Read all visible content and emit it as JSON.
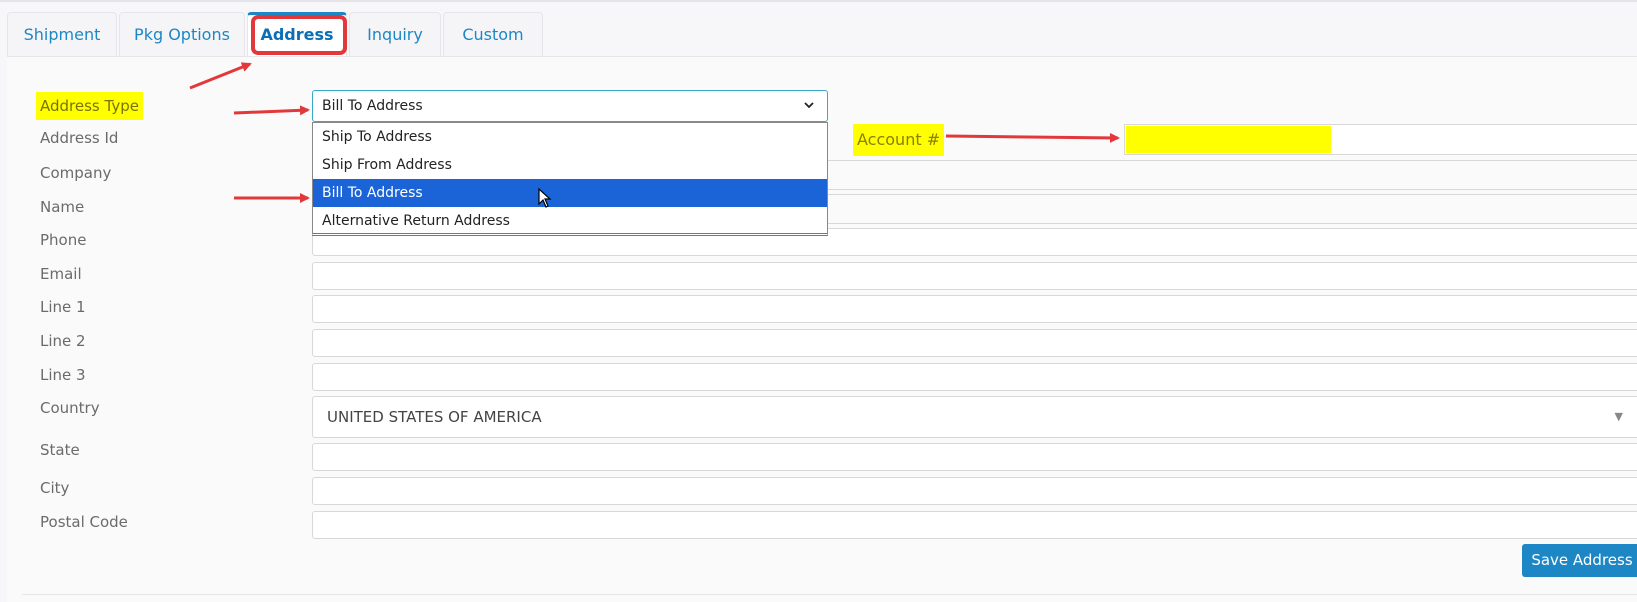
{
  "tabs": [
    {
      "label": "Shipment"
    },
    {
      "label": "Pkg Options"
    },
    {
      "label": "Address"
    },
    {
      "label": "Inquiry"
    },
    {
      "label": "Custom"
    }
  ],
  "active_tab": "Address",
  "form": {
    "address_type_label": "Address Type",
    "address_type_value": "Bill To Address",
    "address_type_options": [
      "Ship To Address",
      "Ship From Address",
      "Bill To Address",
      "Alternative Return Address"
    ],
    "selected_option": "Bill To Address",
    "labels": {
      "address_id": "Address Id",
      "company": "Company",
      "name": "Name",
      "phone": "Phone",
      "email": "Email",
      "line1": "Line 1",
      "line2": "Line 2",
      "line3": "Line 3",
      "country": "Country",
      "state": "State",
      "city": "City",
      "postal_code": "Postal Code"
    },
    "account_label": "Account #",
    "account_value": "",
    "country_value": "UNITED STATES OF AMERICA",
    "save_label": "Save Address"
  },
  "colors": {
    "accent": "#1d87c5",
    "highlight": "#ffff00",
    "annotation": "#e2383b",
    "selection": "#1a64d8"
  },
  "icons": [
    "chevron-down-icon",
    "caret-down-icon",
    "cursor-icon",
    "annotation-arrow-icon"
  ]
}
